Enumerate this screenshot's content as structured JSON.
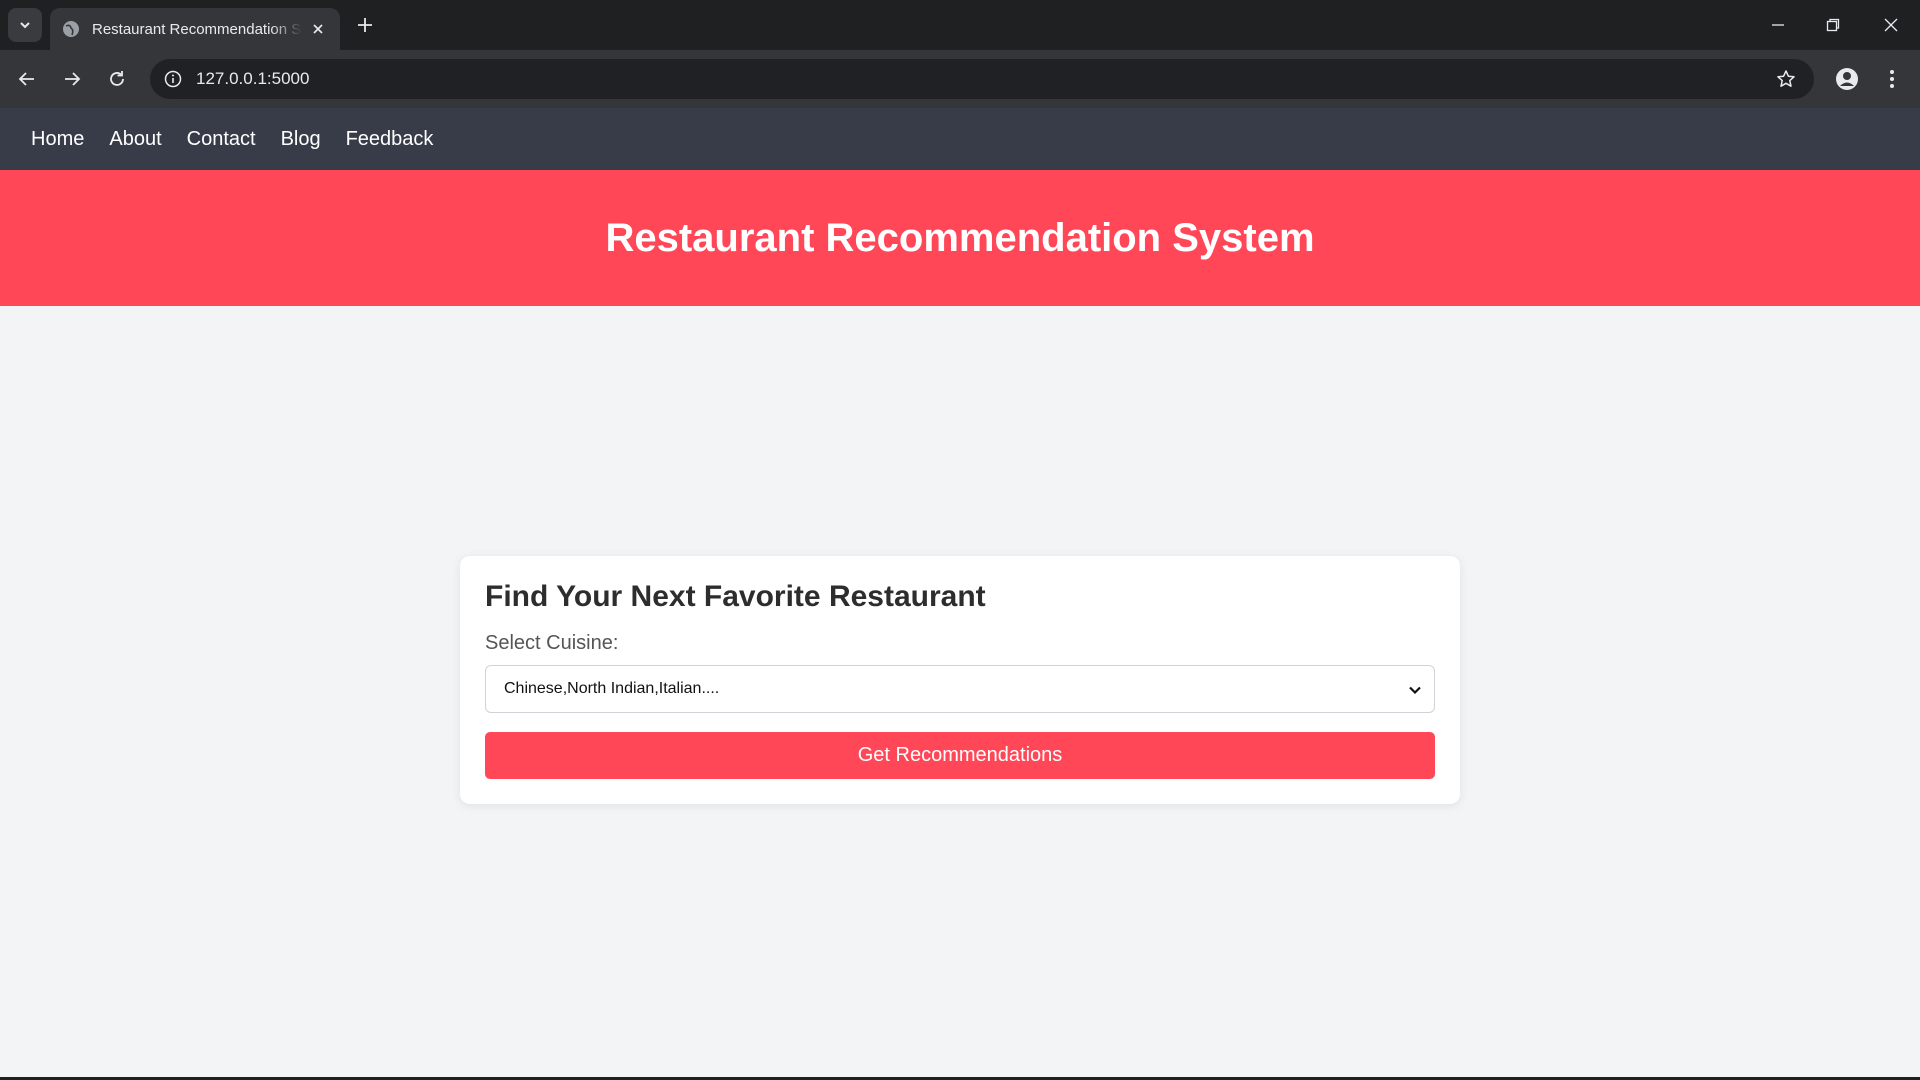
{
  "browser": {
    "tab": {
      "title": "Restaurant Recommendation System",
      "favicon": "globe-icon"
    },
    "address": {
      "url": "127.0.0.1:5000"
    },
    "icons": {
      "tab_menu": "chevron-down-icon",
      "tab_close": "close-icon",
      "new_tab": "plus-icon",
      "back": "arrow-left-icon",
      "forward": "arrow-right-icon",
      "reload": "reload-icon",
      "site_info": "info-icon",
      "bookmark": "star-icon",
      "profile": "profile-icon",
      "menu": "kebab-menu-icon",
      "minimize": "minimize-icon",
      "restore": "restore-icon",
      "close_window": "close-icon"
    }
  },
  "site_nav": {
    "items": [
      {
        "label": "Home"
      },
      {
        "label": "About"
      },
      {
        "label": "Contact"
      },
      {
        "label": "Blog"
      },
      {
        "label": "Feedback"
      }
    ]
  },
  "hero": {
    "title": "Restaurant Recommendation System"
  },
  "form": {
    "heading": "Find Your Next Favorite Restaurant",
    "cuisine_label": "Select Cuisine:",
    "cuisine_selected": "Chinese,North Indian,Italian....",
    "submit_label": "Get Recommendations"
  },
  "colors": {
    "accent": "#ff4757",
    "nav_background": "#373c48",
    "page_background": "#f3f4f6"
  }
}
